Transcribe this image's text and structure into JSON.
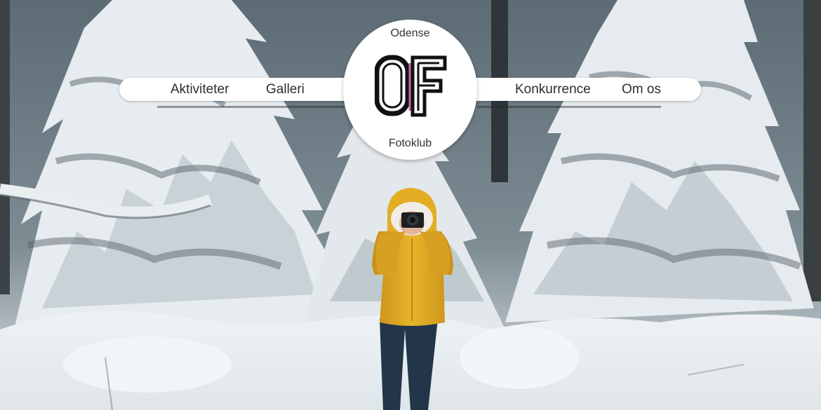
{
  "brand": {
    "top_text": "Odense",
    "monogram": "OF",
    "bottom_text": "Fotoklub",
    "accent_color": "#c86aa6"
  },
  "nav": {
    "left": [
      {
        "label": "Aktiviteter"
      },
      {
        "label": "Galleri"
      }
    ],
    "right": [
      {
        "label": "Konkurrence"
      },
      {
        "label": "Om os"
      }
    ]
  },
  "hero": {
    "jacket_color": "#e3ad24",
    "snow_color": "#f2f5f7"
  }
}
